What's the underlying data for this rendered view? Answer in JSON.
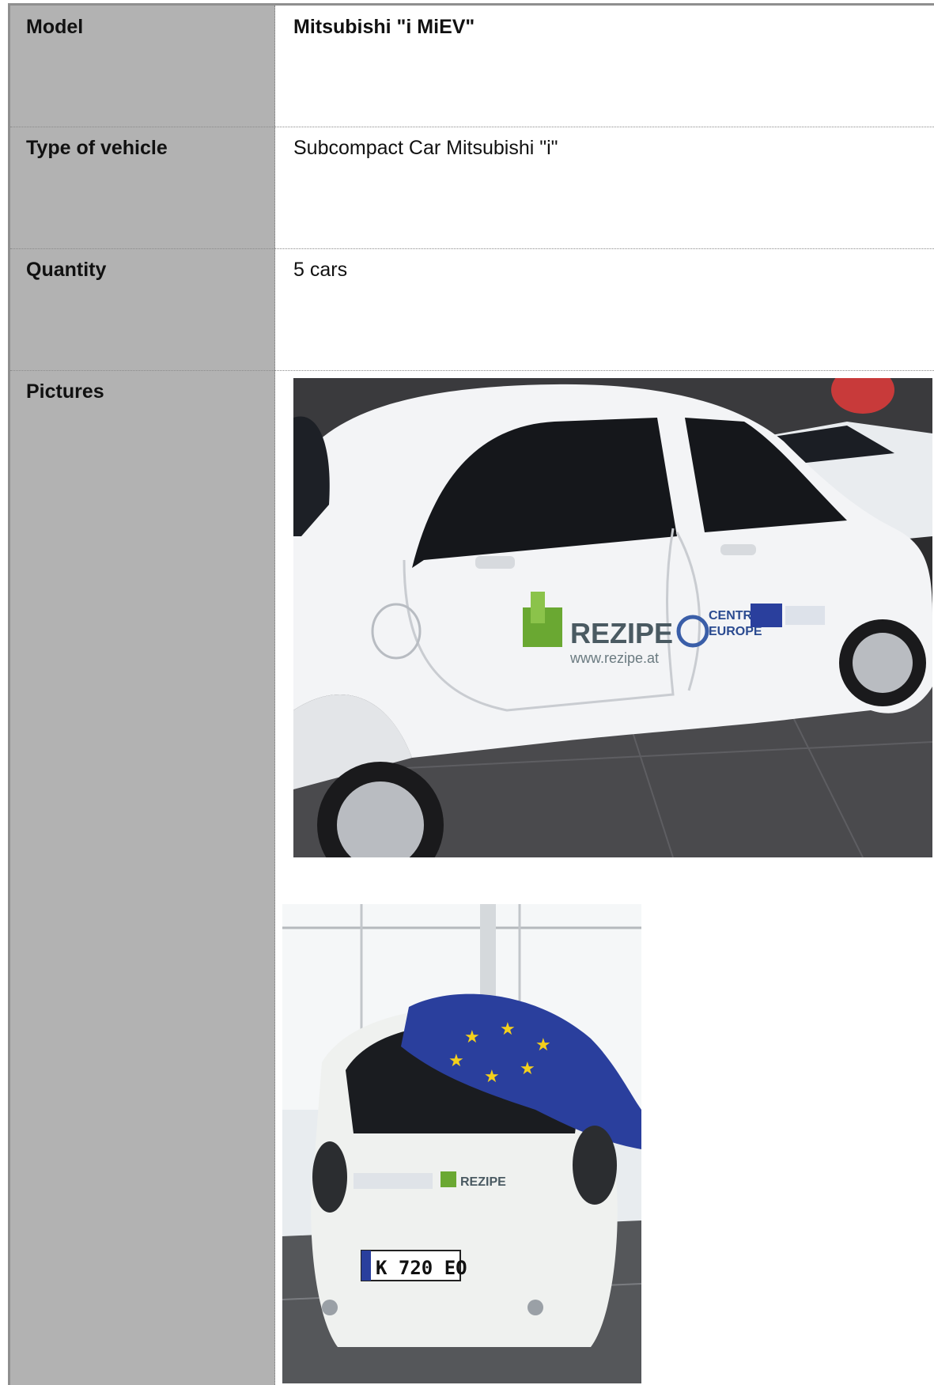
{
  "rows": [
    {
      "label": "Model",
      "value": "Mitsubishi \"i MiEV\""
    },
    {
      "label": "Type of vehicle",
      "value": "Subcompact Car Mitsubishi \"i\""
    },
    {
      "label": "Quantity",
      "value": "5 cars"
    },
    {
      "label": "Pictures",
      "value": ""
    }
  ],
  "photos": {
    "side": {
      "logo_text": "REZIPE",
      "logo_url": "www.rezipe.at",
      "badge_line1": "CENTRAL",
      "badge_line2": "EUROPE"
    },
    "rear": {
      "plate": "K 720 EO",
      "logo_text": "REZIPE"
    }
  },
  "colors": {
    "label_bg": "#b2b2b2",
    "frame": "#8f8f8f",
    "eu_blue": "#2a3f9d",
    "eu_star": "#f4d01c",
    "rezipe_green": "#6aa832"
  }
}
